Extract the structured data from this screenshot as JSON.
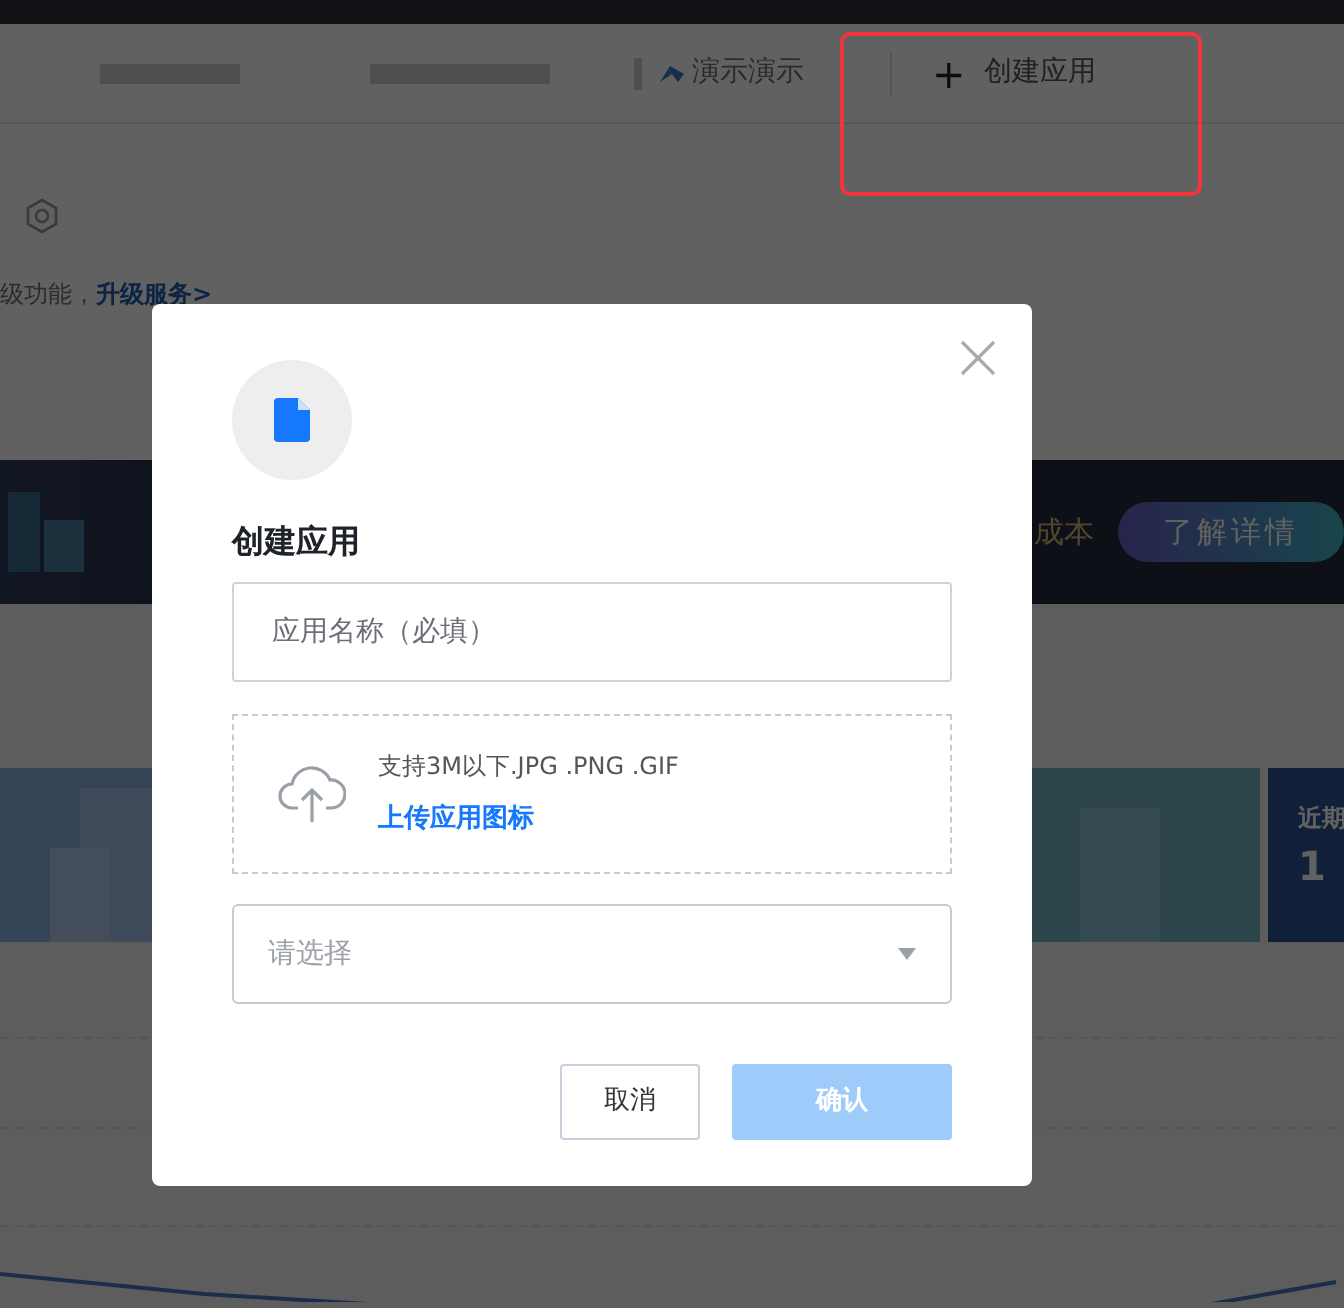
{
  "header": {
    "team_name": "演示演示",
    "create_button": {
      "icon": "+",
      "label": "创建应用",
      "highlighted": true
    }
  },
  "notice": {
    "text": "级功能，",
    "link": "升级服务>"
  },
  "banner": {
    "text": "成本",
    "button": "了解详情"
  },
  "stat_card": {
    "label": "近期",
    "value": "1"
  },
  "dialog": {
    "title": "创建应用",
    "name_field": {
      "placeholder": "应用名称（必填）"
    },
    "upload": {
      "hint": "支持3M以下.JPG .PNG .GIF",
      "link": "上传应用图标"
    },
    "select": {
      "placeholder": "请选择"
    },
    "buttons": [
      {
        "label": "取消",
        "kind": "secondary"
      },
      {
        "label": "确认",
        "kind": "primary",
        "disabled": true
      }
    ]
  }
}
